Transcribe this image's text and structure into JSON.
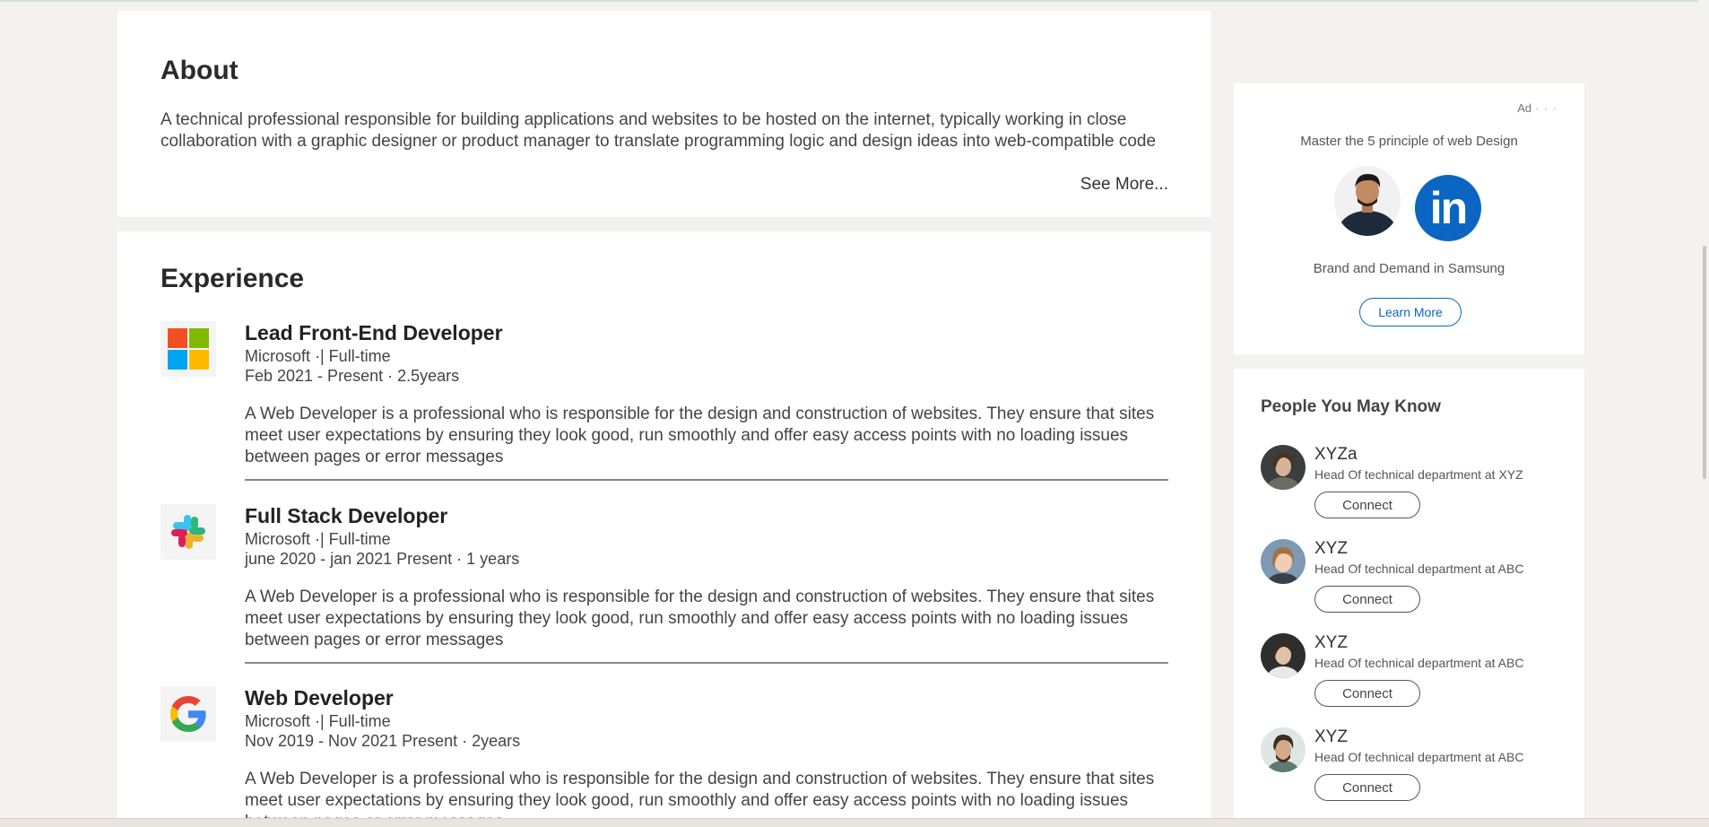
{
  "about": {
    "heading": "About",
    "text": "A technical professional responsible for building applications and websites to be hosted on the internet, typically working in close collaboration with a graphic designer or product manager to translate programming logic and design ideas into web-compatible code",
    "see_more": "See More..."
  },
  "experience": {
    "heading": "Experience",
    "jobs": [
      {
        "title": "Lead Front-End Developer",
        "company": "Microsoft ·| Full-time",
        "dates": "Feb 2021 - Present · 2.5years",
        "description": "A Web Developer is a professional who is responsible for the design and construction of websites. They ensure that sites meet user expectations by ensuring they look good, run smoothly and offer easy access points with no loading issues between pages or error messages",
        "logo": "microsoft-logo-icon"
      },
      {
        "title": "Full Stack Developer",
        "company": "Microsoft ·| Full-time",
        "dates": "june 2020 - jan 2021 Present · 1 years",
        "description": "A Web Developer is a professional who is responsible for the design and construction of websites. They ensure that sites meet user expectations by ensuring they look good, run smoothly and offer easy access points with no loading issues between pages or error messages",
        "logo": "slack-logo-icon"
      },
      {
        "title": "Web Developer",
        "company": "Microsoft ·| Full-time",
        "dates": "Nov 2019 - Nov 2021 Present · 2years",
        "description": "A Web Developer is a professional who is responsible for the design and construction of websites. They ensure that sites meet user expectations by ensuring they look good, run smoothly and offer easy access points with no loading issues between pages or error messages",
        "logo": "google-logo-icon"
      }
    ]
  },
  "ad": {
    "label": "Ad",
    "dots": "· · ·",
    "headline": "Master the 5 principle of web Design",
    "logo_text": "in",
    "company": "Brand and Demand in Samsung",
    "cta": "Learn More",
    "colors": {
      "brand": "#0a66c2"
    }
  },
  "people": {
    "heading": "People You May Know",
    "items": [
      {
        "name": "XYZa",
        "role": "Head Of technical department at XYZ",
        "action": "Connect"
      },
      {
        "name": "XYZ",
        "role": "Head Of technical department at ABC",
        "action": "Connect"
      },
      {
        "name": "XYZ",
        "role": "Head Of technical department at ABC",
        "action": "Connect"
      },
      {
        "name": "XYZ",
        "role": "Head Of technical department at ABC",
        "action": "Connect"
      }
    ]
  }
}
